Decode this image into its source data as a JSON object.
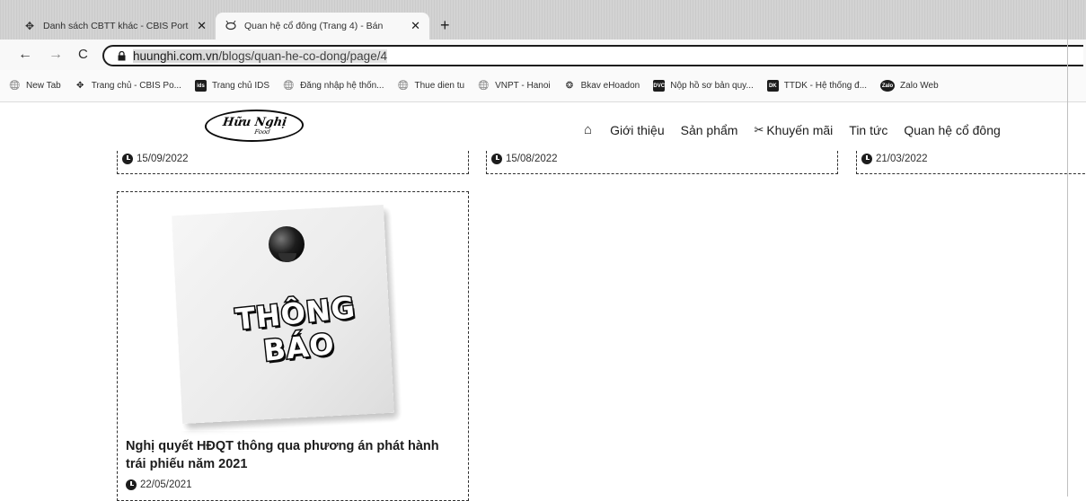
{
  "browser": {
    "tabs": [
      {
        "label": "Danh sách CBTT khác - CBIS Port",
        "icon": "site-icon",
        "active": false
      },
      {
        "label": "Quan hệ cổ đông (Trang 4) - Bán",
        "icon": "bee-icon",
        "active": true
      }
    ],
    "close_glyph": "✕",
    "new_tab_glyph": "+",
    "nav": {
      "back": "←",
      "forward": "→",
      "reload": "C"
    },
    "url_host": "huunghi.com.vn",
    "url_path": "/blogs/quan-he-co-dong/page/4",
    "bookmarks": [
      {
        "label": "New Tab",
        "icon": "globe-icon",
        "glyph": "🌐"
      },
      {
        "label": "Trang chủ - CBIS Po...",
        "icon": "site-icon",
        "glyph": "✥"
      },
      {
        "label": "Trang chủ IDS",
        "icon": "ids-icon",
        "glyph": "ids"
      },
      {
        "label": "Đăng nhập hệ thốn...",
        "icon": "globe-icon",
        "glyph": "🌐"
      },
      {
        "label": "Thue dien tu",
        "icon": "globe-icon",
        "glyph": "🌐"
      },
      {
        "label": "VNPT - Hanoi",
        "icon": "globe-icon",
        "glyph": "🌐"
      },
      {
        "label": "Bkav eHoadon",
        "icon": "bkav-icon",
        "glyph": "❂"
      },
      {
        "label": "Nộp hồ sơ bản quy...",
        "icon": "dvc-icon",
        "glyph": "DVC"
      },
      {
        "label": "TTDK - Hệ thống đ...",
        "icon": "ttdk-icon",
        "glyph": "DK"
      },
      {
        "label": "Zalo Web",
        "icon": "zalo-icon",
        "glyph": "Zalo"
      }
    ]
  },
  "site": {
    "logo_main": "Hữu Nghị",
    "logo_sub": "Food",
    "nav": {
      "home_glyph": "⌂",
      "items": [
        "Giới thiệu",
        "Sản phẩm",
        "Khuyến mãi",
        "Tin tức",
        "Quan hệ cổ đông"
      ]
    }
  },
  "posts": {
    "previous_row_dates": [
      "15/09/2022",
      "15/08/2022",
      "21/03/2022"
    ],
    "card": {
      "image_text": "THÔNG BÁO",
      "title": "Nghị quyết HĐQT thông qua phương án phát hành trái phiếu năm 2021",
      "date": "22/05/2021"
    }
  }
}
